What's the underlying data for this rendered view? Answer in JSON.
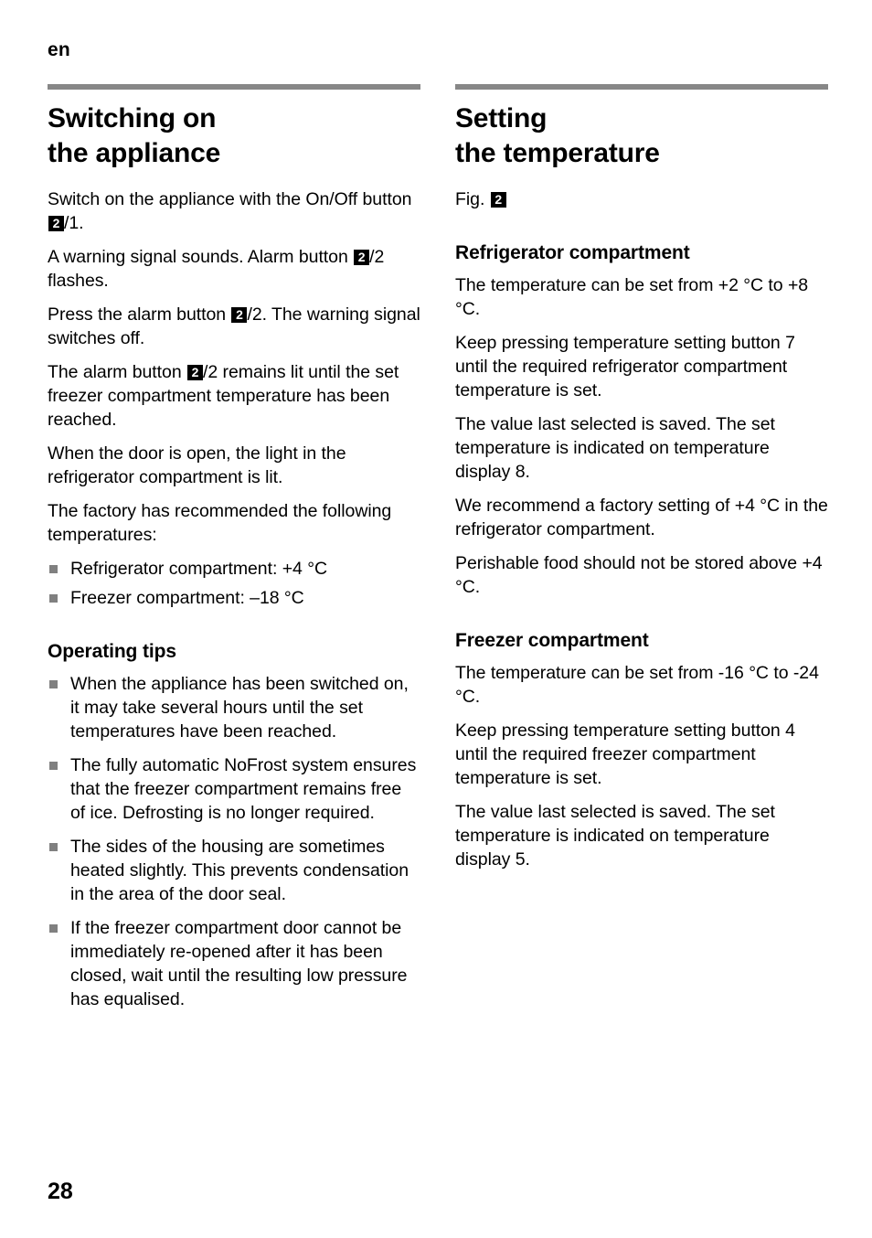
{
  "page": {
    "running_head": "en",
    "folio": "28",
    "rule_color": "#878787",
    "bullet_color": "#808080",
    "figref_bg": "#000000",
    "figref_fg": "#ffffff"
  },
  "left_column": {
    "title": "Switching on\nthe appliance",
    "paragraphs": [
      {
        "id": "p1",
        "before": "Switch on the appliance with the On/Off button ",
        "figref": "2",
        "after": "/1."
      },
      {
        "id": "p2",
        "before": "A warning signal sounds. Alarm button ",
        "figref": "2",
        "after": "/2 flashes."
      },
      {
        "id": "p3",
        "before": "Press the alarm button ",
        "figref": "2",
        "after": "/2. The warning signal switches off."
      },
      {
        "id": "p4",
        "before": "The alarm button ",
        "figref": "2",
        "after": "/2 remains lit until the set freezer compartment temperature has been reached."
      },
      {
        "id": "p5",
        "text": "When the door is open, the light in the refrigerator compartment is lit."
      },
      {
        "id": "p6",
        "text": "The factory has recommended the following temperatures:"
      }
    ],
    "temperature_bullets": [
      "Refrigerator compartment: +4 °C",
      "Freezer compartment:  –18 °C"
    ],
    "operating_tips": {
      "heading": "Operating tips",
      "bullets": [
        "When the appliance has been switched on, it may take several hours until the set temperatures have been reached.",
        "The fully automatic NoFrost system ensures that the freezer compartment remains free of ice. Defrosting is no longer required.",
        "The sides of the housing are sometimes heated slightly. This prevents condensation in the area of the door seal.",
        "If the freezer compartment door cannot be immediately re-opened after it has been closed, wait until the resulting low pressure has equalised."
      ]
    }
  },
  "right_column": {
    "title": "Setting\nthe temperature",
    "fig_label": {
      "before": "Fig. ",
      "figref": "2",
      "after": ""
    },
    "refrigerator": {
      "heading": "Refrigerator compartment",
      "paragraphs": [
        "The temperature can be set from +2 °C to +8 °C.",
        "Keep pressing temperature setting button 7 until the required refrigerator compartment temperature is set.",
        "The value last selected is saved. The set temperature is indicated on temperature display 8.",
        "We recommend a factory setting of +4 °C in the refrigerator compartment.",
        "Perishable food should not be stored above +4 °C."
      ]
    },
    "freezer": {
      "heading": "Freezer compartment",
      "paragraphs": [
        "The temperature can be set from -16 °C to -24 °C.",
        "Keep pressing temperature setting button 4 until the required freezer compartment temperature is set.",
        "The value last selected is saved. The set temperature is indicated on temperature display 5."
      ]
    }
  }
}
